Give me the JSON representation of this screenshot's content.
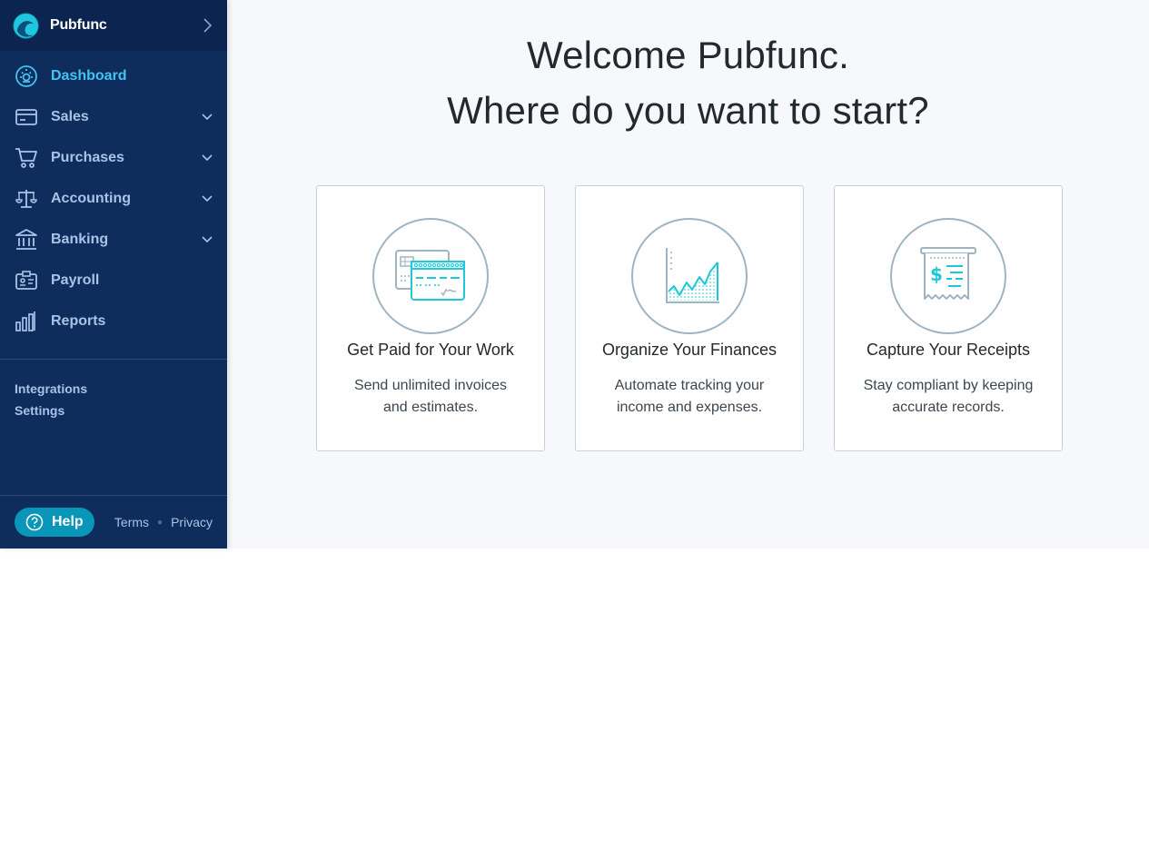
{
  "brand": {
    "name": "Pubfunc"
  },
  "nav": [
    {
      "label": "Dashboard",
      "icon": "dashboard-icon",
      "active": true,
      "expandable": false
    },
    {
      "label": "Sales",
      "icon": "credit-card-icon",
      "active": false,
      "expandable": true
    },
    {
      "label": "Purchases",
      "icon": "cart-icon",
      "active": false,
      "expandable": true
    },
    {
      "label": "Accounting",
      "icon": "scale-icon",
      "active": false,
      "expandable": true
    },
    {
      "label": "Banking",
      "icon": "bank-icon",
      "active": false,
      "expandable": true
    },
    {
      "label": "Payroll",
      "icon": "id-badge-icon",
      "active": false,
      "expandable": false
    },
    {
      "label": "Reports",
      "icon": "bar-chart-icon",
      "active": false,
      "expandable": false
    }
  ],
  "secondary": {
    "integrations": "Integrations",
    "settings": "Settings"
  },
  "footer": {
    "help": "Help",
    "terms": "Terms",
    "privacy": "Privacy"
  },
  "welcome": {
    "line1": "Welcome Pubfunc.",
    "line2": "Where do you want to start?"
  },
  "cards": [
    {
      "title": "Get Paid for Your Work",
      "desc": "Send unlimited invoices and estimates.",
      "icon": "invoice-icon"
    },
    {
      "title": "Organize Your Finances",
      "desc": "Automate tracking your income and expenses.",
      "icon": "chart-icon"
    },
    {
      "title": "Capture Your Receipts",
      "desc": "Stay compliant by keeping accurate records.",
      "icon": "receipt-icon"
    }
  ],
  "colors": {
    "sidebar": "#0f2d5c",
    "brand_bar": "#0b2550",
    "accent": "#40c4f2",
    "help_button": "#0996b9",
    "main_bg": "#f7f8fb"
  }
}
